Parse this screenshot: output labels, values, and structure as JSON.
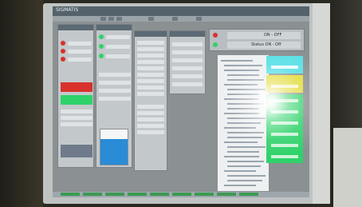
{
  "app": {
    "title": "SIGMATIS"
  },
  "panels": {
    "alarm_header": "ON - OFF",
    "alarm_sub": "Status ON - Off"
  },
  "colors": {
    "alarm_red": "#d8322c",
    "ok_green": "#2fd26a",
    "level_blue": "#2a8bd6",
    "status_cyan": "#58e0e6",
    "status_yellow": "#e2dc3a"
  },
  "icons": [
    "red-status-led",
    "green-status-led",
    "tree-node-icon"
  ]
}
